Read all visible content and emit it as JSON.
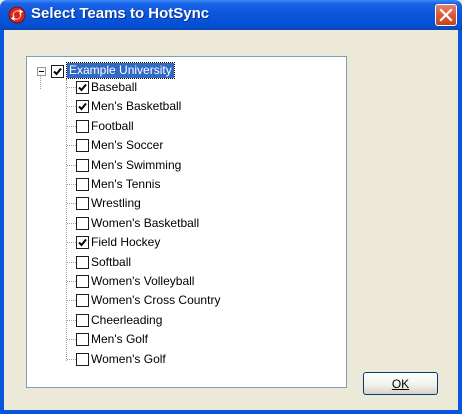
{
  "window": {
    "title": "Select Teams to HotSync"
  },
  "tree": {
    "root": {
      "label": "Example University",
      "checked": true
    },
    "items": [
      {
        "label": "Baseball",
        "checked": true
      },
      {
        "label": "Men's Basketball",
        "checked": true
      },
      {
        "label": "Football",
        "checked": false
      },
      {
        "label": "Men's Soccer",
        "checked": false
      },
      {
        "label": "Men's Swimming",
        "checked": false
      },
      {
        "label": "Men's Tennis",
        "checked": false
      },
      {
        "label": "Wrestling",
        "checked": false
      },
      {
        "label": "Women's Basketball",
        "checked": false
      },
      {
        "label": "Field Hockey",
        "checked": true
      },
      {
        "label": "Softball",
        "checked": false
      },
      {
        "label": "Women's Volleyball",
        "checked": false
      },
      {
        "label": "Women's Cross Country",
        "checked": false
      },
      {
        "label": "Cheerleading",
        "checked": false
      },
      {
        "label": "Men's Golf",
        "checked": false
      },
      {
        "label": "Women's Golf",
        "checked": false
      }
    ]
  },
  "buttons": {
    "ok_label": "OK"
  },
  "colors": {
    "selection": "#316ac5",
    "titlebar": "#0a55dd",
    "close": "#d9593a"
  }
}
